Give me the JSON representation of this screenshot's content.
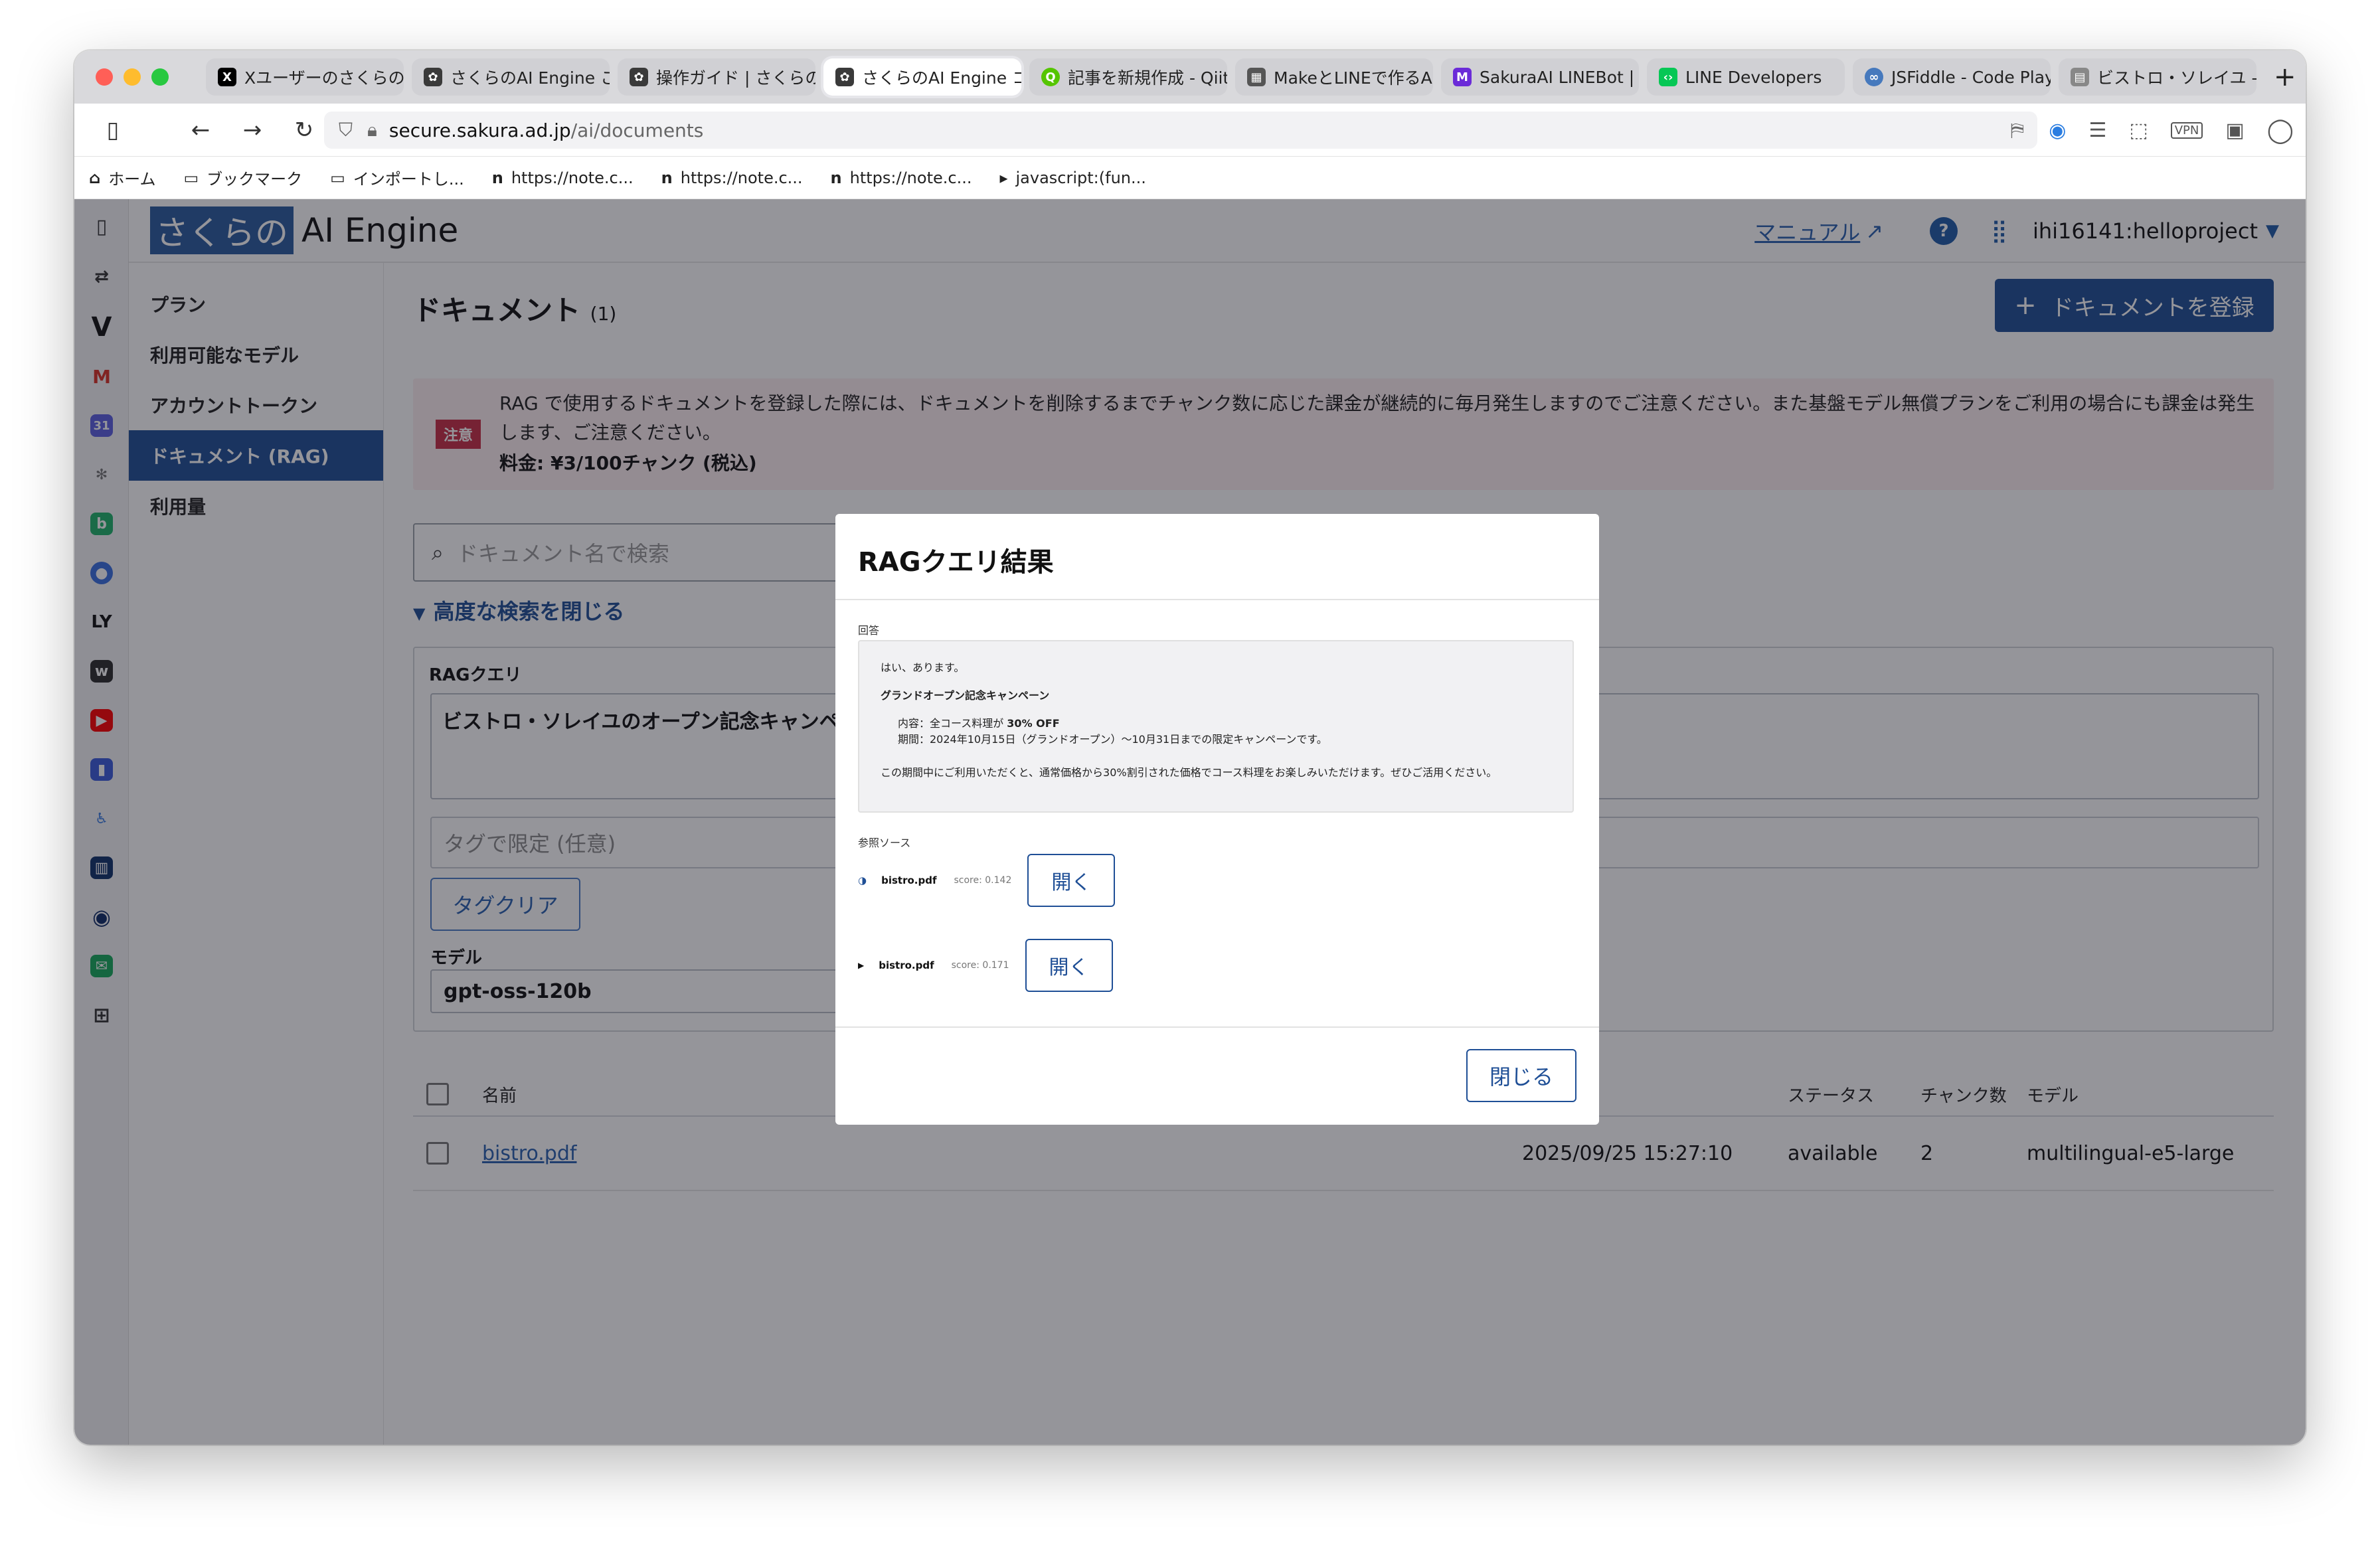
{
  "browser": {
    "tabs": [
      {
        "label": "Xユーザーのさくらの",
        "color": "#000000",
        "icon": "x-logo-icon"
      },
      {
        "label": "さくらのAI Engine こ",
        "color": "#444444",
        "icon": "sakura-icon"
      },
      {
        "label": "操作ガイド | さくらの",
        "color": "#444444",
        "icon": "sakura-icon"
      },
      {
        "label": "さくらのAI Engine コ",
        "color": "#444444",
        "icon": "sakura-icon"
      },
      {
        "label": "記事を新規作成 - Qiit",
        "color": "#55c500",
        "icon": "qiita-icon"
      },
      {
        "label": "MakeとLINEで作るAI",
        "color": "#555555",
        "icon": "article-icon"
      },
      {
        "label": "SakuraAI LINEBot | M",
        "color": "#6b2bd8",
        "icon": "make-icon"
      },
      {
        "label": "LINE Developers",
        "color": "#06c755",
        "icon": "line-icon"
      },
      {
        "label": "JSFiddle - Code Play",
        "color": "#4679bd",
        "icon": "jsfiddle-icon"
      },
      {
        "label": "ビストロ・ソレイユ -",
        "color": "#666666",
        "icon": "document-icon"
      }
    ],
    "url_host": "secure.sakura.ad.jp",
    "url_path": "/ai/documents",
    "bookmarks": [
      "ホーム",
      "ブックマーク",
      "インポートし...",
      "https://note.c...",
      "https://note.c...",
      "https://note.c...",
      "javascript:(fun..."
    ]
  },
  "app": {
    "logo_highlight": "さくらの",
    "logo_rest": "AI Engine",
    "manual_link": "マニュアル",
    "help_icon": "?",
    "user": "ihi16141:helloproject"
  },
  "nav": [
    "プラン",
    "利用可能なモデル",
    "アカウントトークン",
    "ドキュメント (RAG)",
    "利用量"
  ],
  "page": {
    "title": "ドキュメント",
    "count": "(1)",
    "register_button": "ドキュメントを登録",
    "notice_badge": "注意",
    "notice_text": "RAG で使用するドキュメントを登録した際には、ドキュメントを削除するまでチャンク数に応じた課金が継続的に毎月発生しますのでご注意ください。また基盤モデル無償プランをご利用の場合にも課金は発生します、ご注意ください。",
    "notice_fee": "料金: ¥3/100チャンク (税込)",
    "search_placeholder": "ドキュメント名で検索",
    "advanced_toggle": "高度な検索を閉じる",
    "rag_label": "RAGクエリ",
    "rag_query": "ビストロ・ソレイユのオープン記念キャンペーン",
    "tag_placeholder": "タグで限定 (任意)",
    "tag_clear": "タグクリア",
    "model_label": "モデル",
    "model_value": "gpt-oss-120b"
  },
  "table": {
    "headers": {
      "name": "名前",
      "status": "ステータス",
      "chunks": "チャンク数",
      "model": "モデル"
    },
    "rows": [
      {
        "name": "bistro.pdf",
        "date": "2025/09/25 15:27:10",
        "status": "available",
        "chunks": "2",
        "model": "multilingual-e5-large"
      }
    ]
  },
  "modal": {
    "title": "RAGクエリ結果",
    "answer_label": "回答",
    "answer_line1": "はい、あります。",
    "answer_heading": "グランドオープン記念キャンペーン",
    "answer_item1_prefix": "内容：全コース料理が ",
    "answer_item1_bold": "30% OFF",
    "answer_item2": "期間：2024年10月15日（グランドオープン）～10月31日までの限定キャンペーンです。",
    "answer_closing": "この期間中にご利用いただくと、通常価格から30%割引された価格でコース料理をお楽しみいただけます。ぜひご活用ください。",
    "sources_label": "参照ソース",
    "sources": [
      {
        "file": "bistro.pdf",
        "score": "score: 0.142",
        "open": "開く"
      },
      {
        "file": "bistro.pdf",
        "score": "score: 0.171",
        "open": "開く"
      }
    ],
    "close_button": "閉じる"
  }
}
